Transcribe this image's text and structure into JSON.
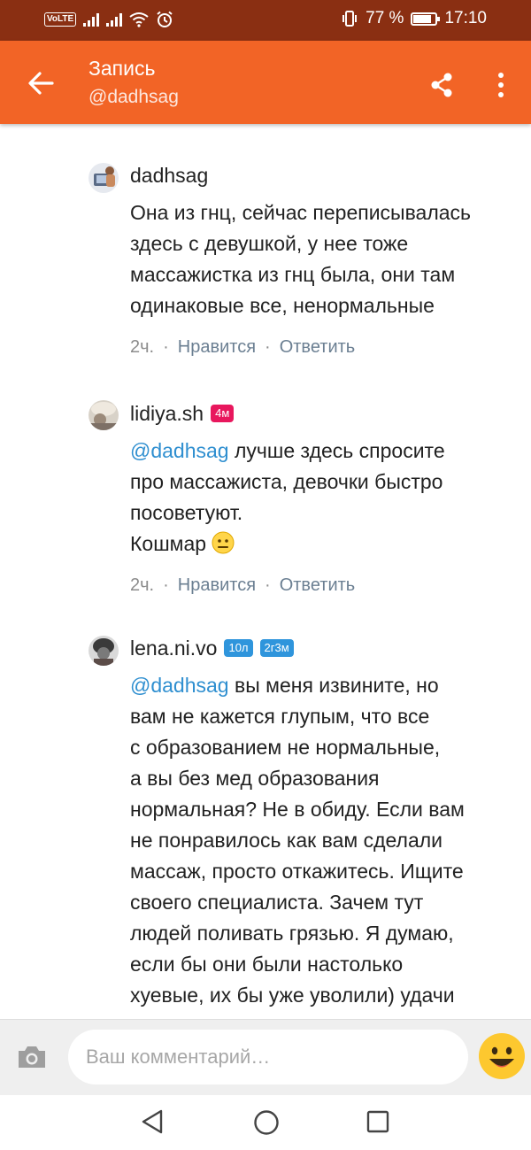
{
  "status_bar": {
    "volte": "VoLTE",
    "battery_percent_text": "77 %",
    "battery_level": 0.77,
    "time": "17:10"
  },
  "app_bar": {
    "title": "Запись",
    "subtitle": "@dadhsag",
    "back_icon": "arrow-left-icon",
    "share_icon": "share-icon",
    "more_icon": "more-vert-icon"
  },
  "comments": [
    {
      "username": "dadhsag",
      "badges": [],
      "mention": "",
      "lines": [
        "Она из гнц, сейчас переписывалась",
        "здесь с девушкой, у нее тоже",
        "массажистка из гнц была, они там",
        "одинаковые все, ненормальные"
      ],
      "time": "2ч.",
      "like_label": "Нравится",
      "reply_label": "Ответить"
    },
    {
      "username": "lidiya.sh",
      "badges": [
        "4м"
      ],
      "mention": "@dadhsag",
      "lines": [
        " лучше здесь спросите",
        "про массажиста, девочки быстро",
        "посоветуют.",
        "Кошмар"
      ],
      "time": "2ч.",
      "like_label": "Нравится",
      "reply_label": "Ответить"
    },
    {
      "username": "lena.ni.vo",
      "badges": [
        "10л",
        "2г3м"
      ],
      "mention": "@dadhsag",
      "lines": [
        " вы меня извините, но",
        "вам не кажется глупым, что все",
        "с образованием не нормальные,",
        "а вы без мед образования",
        "нормальная? Не в обиду. Если вам",
        "не понравилось как вам сделали",
        "массаж, просто откажитесь. Ищите",
        "своего специалиста. Зачем тут",
        "людей поливать грязью. Я думаю,",
        "если бы они были настолько",
        "хуевые, их бы уже уволили) удачи"
      ]
    }
  ],
  "composer": {
    "placeholder": "Ваш комментарий…",
    "camera_icon": "camera-icon",
    "emoji_icon": "smiley-emoji-icon"
  },
  "colors": {
    "accent": "#f26426",
    "status_bar": "#8a2f12",
    "mention": "#2f8fd0",
    "badge_pink": "#e8175d",
    "badge_blue": "#2f95dc"
  }
}
